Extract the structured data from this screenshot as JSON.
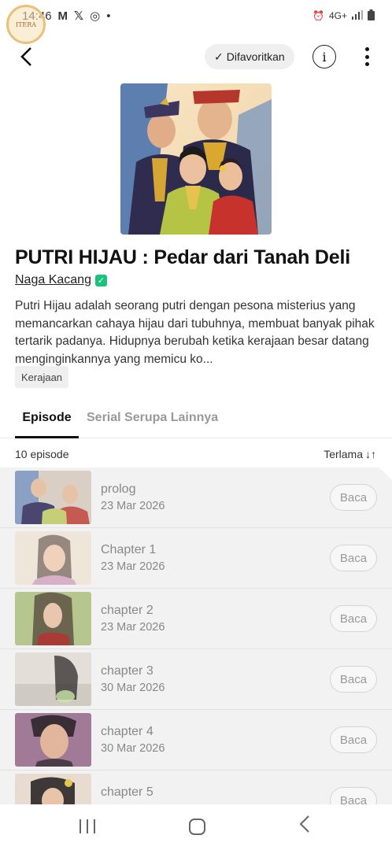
{
  "status_bar": {
    "time": "14:46",
    "notification_icons": [
      "gmail-icon",
      "x-icon",
      "app-icon"
    ],
    "right_icons": [
      "alarm-icon",
      "network-4g-icon",
      "signal-icon",
      "battery-icon"
    ],
    "network_label": "4G+"
  },
  "header": {
    "favorite_label": "Difavoritkan",
    "info_label": "i"
  },
  "series": {
    "title": "PUTRI HIJAU : Pedar dari Tanah Deli",
    "author": "Naga Kacang",
    "synopsis": "Putri Hijau adalah seorang putri dengan pesona misterius yang memancarkan cahaya hijau dari tubuhnya, membuat banyak pihak tertarik padanya. Hidupnya berubah ketika kerajaan besar datang menginginkannya yang memicu ko...",
    "tag": "Kerajaan"
  },
  "tabs": {
    "episode": "Episode",
    "similar": "Serial Serupa Lainnya"
  },
  "list": {
    "count": "10 episode",
    "sort": "Terlama",
    "read_label": "Baca",
    "episodes": [
      {
        "title": "prolog",
        "date": "23 Mar 2026"
      },
      {
        "title": "Chapter 1",
        "date": "23 Mar 2026"
      },
      {
        "title": "chapter 2",
        "date": "23 Mar 2026"
      },
      {
        "title": "chapter 3",
        "date": "30 Mar 2026"
      },
      {
        "title": "chapter 4",
        "date": "30 Mar 2026"
      },
      {
        "title": "chapter 5",
        "date": ""
      }
    ]
  },
  "colors": {
    "accent_green": "#19c37d",
    "list_bg": "#f2f2f2"
  }
}
